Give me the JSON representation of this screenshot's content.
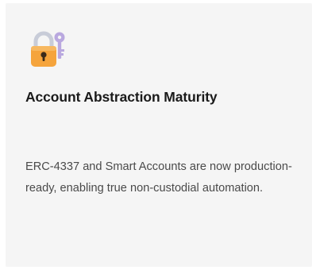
{
  "card": {
    "icon": "lock-with-key-icon",
    "title": "Account Abstraction Maturity",
    "description": "ERC-4337 and Smart Accounts are now production-ready, enabling true non-custodial automation."
  },
  "colors": {
    "card_background": "#f5f5f5",
    "lock_body": "#f5a43c",
    "lock_shackle": "#c8ccd8",
    "key": "#b9a8df"
  }
}
